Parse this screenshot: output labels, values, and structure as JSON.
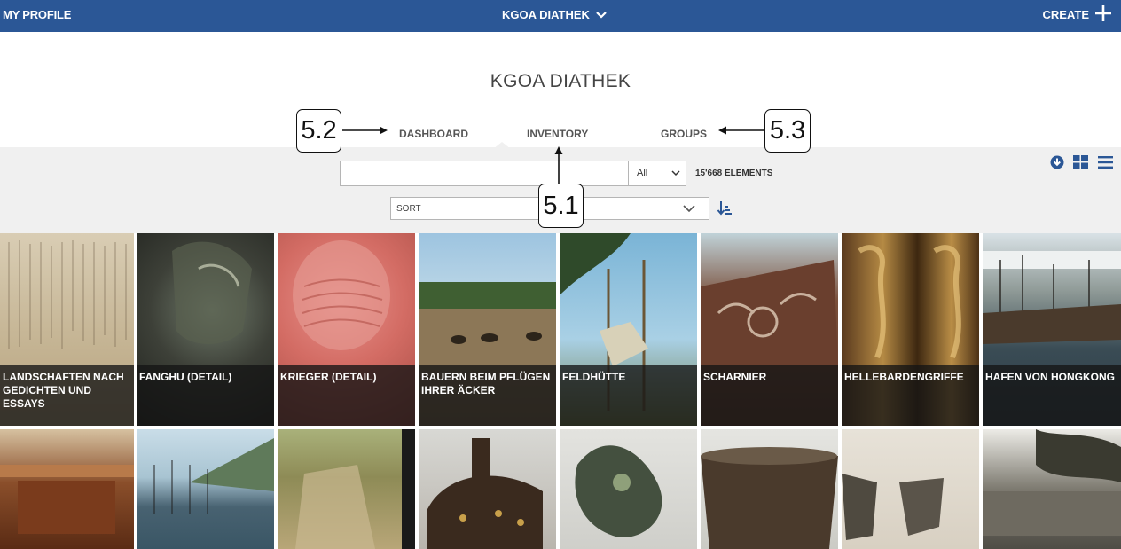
{
  "topbar": {
    "my_profile": "MY PROFILE",
    "app_name": "KGOA DIATHEK",
    "create": "CREATE"
  },
  "page_title": "KGOA DIATHEK",
  "nav": {
    "dashboard": "DASHBOARD",
    "inventory": "INVENTORY",
    "groups": "GROUPS"
  },
  "search": {
    "value": "",
    "scope_selected": "All",
    "count": "15'668 ELEMENTS"
  },
  "sort": {
    "label": "SORT"
  },
  "callouts": {
    "inventory": "5.1",
    "dashboard": "5.2",
    "groups": "5.3"
  },
  "colors": {
    "brand": "#2b5796",
    "band": "#f0f0f0"
  },
  "tiles_row1": [
    {
      "caption": "LANDSCHAFTEN NACH GEDICHTEN UND ESSAYS"
    },
    {
      "caption": "FANGHU (DETAIL)"
    },
    {
      "caption": "KRIEGER (DETAIL)"
    },
    {
      "caption": "BAUERN BEIM PFLÜGEN IHRER ÄCKER"
    },
    {
      "caption": "FELDHÜTTE"
    },
    {
      "caption": "SCHARNIER"
    },
    {
      "caption": "HELLEBARDENGRIFFE"
    },
    {
      "caption": "HAFEN VON HONGKONG"
    }
  ]
}
